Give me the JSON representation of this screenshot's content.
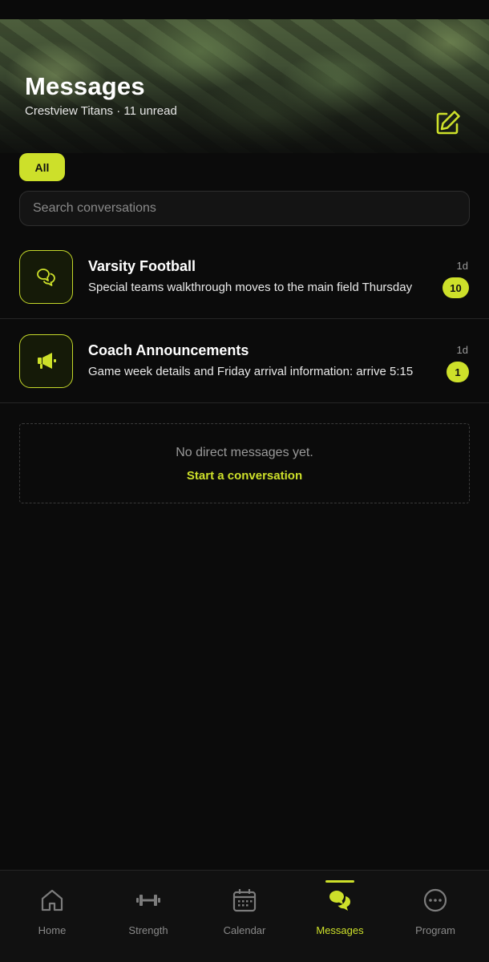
{
  "header": {
    "title": "Messages",
    "subtitle": "Crestview Titans · 11 unread"
  },
  "filters": [
    {
      "label": "All",
      "selected": true
    }
  ],
  "search": {
    "placeholder": "Search conversations",
    "value": ""
  },
  "conversations": [
    {
      "title": "Varsity Football",
      "time": "1d",
      "preview": "Special teams walkthrough moves to the main field Thursday",
      "unread": "10",
      "icon": "chat-bubbles-icon"
    },
    {
      "title": "Coach Announcements",
      "time": "1d",
      "preview": "Game week details and Friday arrival information: arrive 5:15",
      "unread": "1",
      "icon": "megaphone-icon"
    }
  ],
  "empty_state": {
    "text": "No direct messages yet.",
    "link": "Start a conversation"
  },
  "bottom_nav": [
    {
      "label": "Home",
      "icon": "home-icon",
      "active": false
    },
    {
      "label": "Strength",
      "icon": "dumbbell-icon",
      "active": false
    },
    {
      "label": "Calendar",
      "icon": "calendar-icon",
      "active": false
    },
    {
      "label": "Messages",
      "icon": "chat-bubbles-icon",
      "active": true
    },
    {
      "label": "Program",
      "icon": "more-circle-icon",
      "active": false
    }
  ],
  "colors": {
    "accent": "#cde02a",
    "background": "#0b0b0b",
    "muted_text": "#8a8a8a"
  }
}
